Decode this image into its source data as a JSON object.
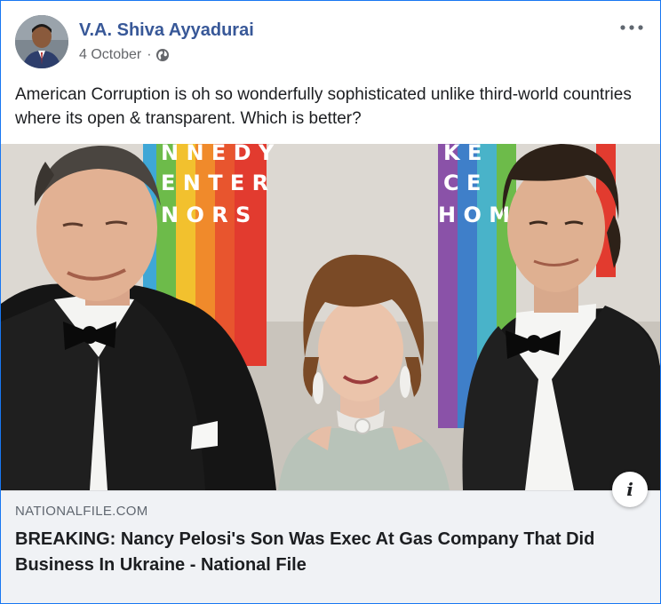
{
  "post": {
    "author": "V.A. Shiva Ayyadurai",
    "date": "4 October",
    "separator": "·",
    "privacy_icon": "globe-icon",
    "more_icon": "more-options-icon",
    "text": "American Corruption is oh so wonderfully sophisticated unlike third-world countries where its open & transparent. Which is better?"
  },
  "photo": {
    "backdrop_letters_left": [
      "N N E D Y",
      "E N T E R",
      "N O R S"
    ],
    "backdrop_letters_right": [
      "K E",
      "C E",
      "H O M"
    ]
  },
  "link_preview": {
    "domain": "NATIONALFILE.COM",
    "headline": "BREAKING: Nancy Pelosi's Son Was Exec At Gas Company That Did Business In Ukraine - National File",
    "info_label": "i"
  },
  "colors": {
    "author_link": "#385898",
    "border": "#1877f2",
    "link_box_bg": "#f0f2f5"
  }
}
